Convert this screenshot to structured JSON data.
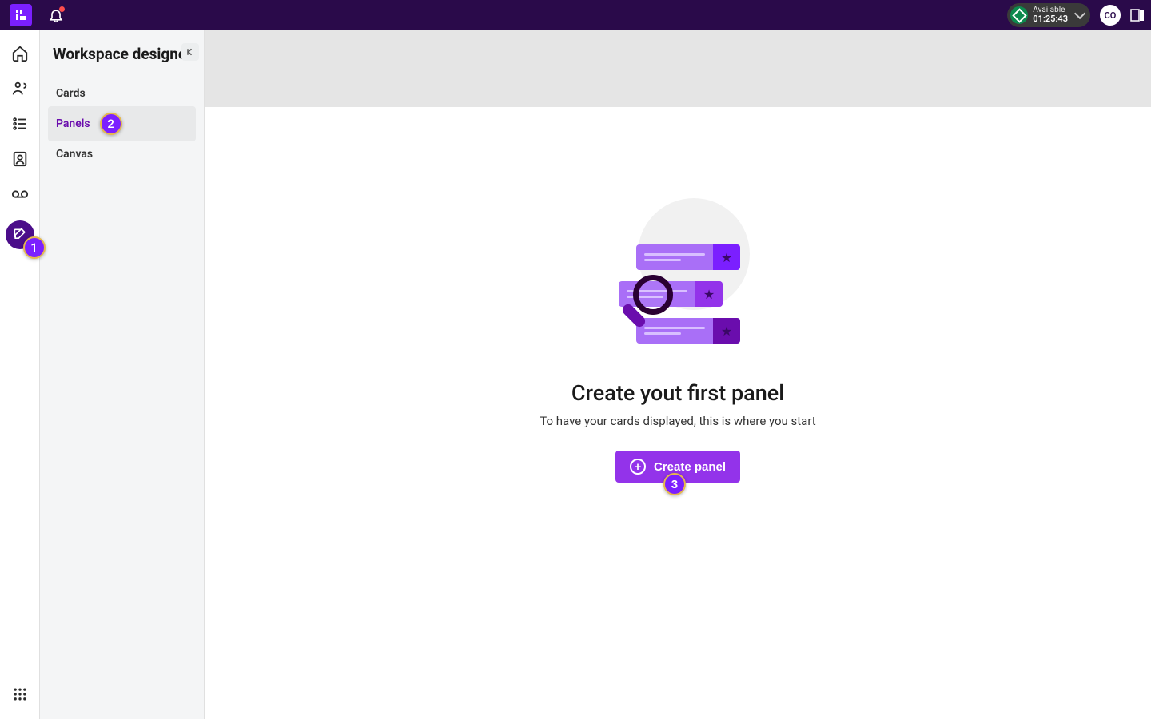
{
  "topbar": {
    "status_label": "Available",
    "status_time": "01:25:43",
    "avatar_initials": "CO"
  },
  "sidepanel": {
    "title": "Workspace designer",
    "items": [
      {
        "label": "Cards"
      },
      {
        "label": "Panels"
      },
      {
        "label": "Canvas"
      }
    ]
  },
  "callouts": {
    "rail": "1",
    "panels": "2",
    "button": "3"
  },
  "empty": {
    "title": "Create yout first panel",
    "subtitle": "To have your cards displayed, this is where you start",
    "button_label": "Create panel"
  }
}
